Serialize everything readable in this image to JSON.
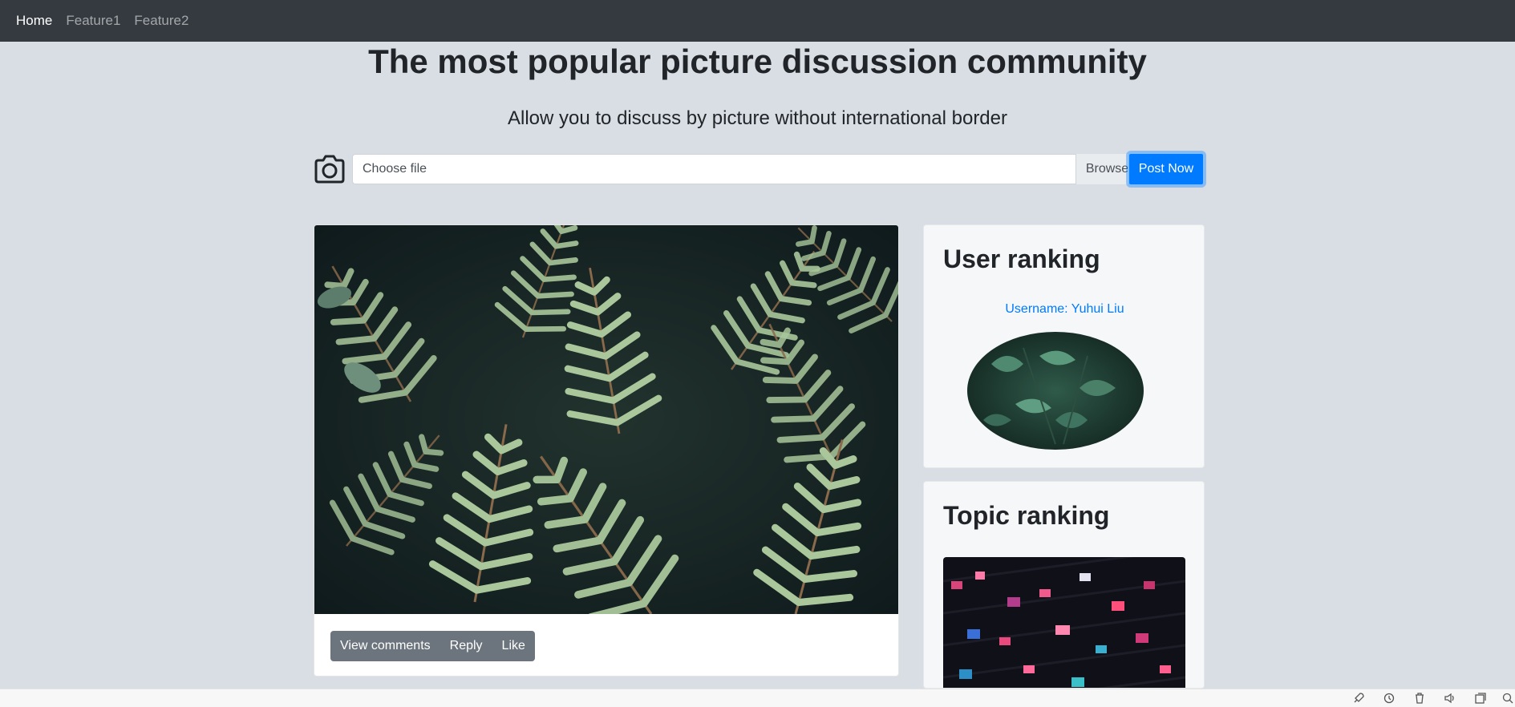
{
  "nav": {
    "items": [
      {
        "label": "Home",
        "active": true
      },
      {
        "label": "Feature1",
        "active": false
      },
      {
        "label": "Feature2",
        "active": false
      }
    ]
  },
  "hero": {
    "title": "The most popular picture discussion community",
    "subtitle": "Allow you to discuss by picture without international border"
  },
  "upload": {
    "icon": "camera-icon",
    "placeholder": "Choose file",
    "browse_label": "Browse",
    "post_label": "Post Now"
  },
  "post": {
    "image": "fern-leaves-photo",
    "actions": [
      "View comments",
      "Reply",
      "Like"
    ]
  },
  "user_ranking": {
    "title": "User ranking",
    "username": "Username: Yuhui Liu",
    "avatar": "green-leaves-photo"
  },
  "topic_ranking": {
    "title": "Topic ranking",
    "image": "neon-building-photo"
  },
  "colors": {
    "navbar": "#343a40",
    "page_bg": "#d9dee4",
    "primary": "#007bff",
    "secondary": "#6c757d"
  }
}
